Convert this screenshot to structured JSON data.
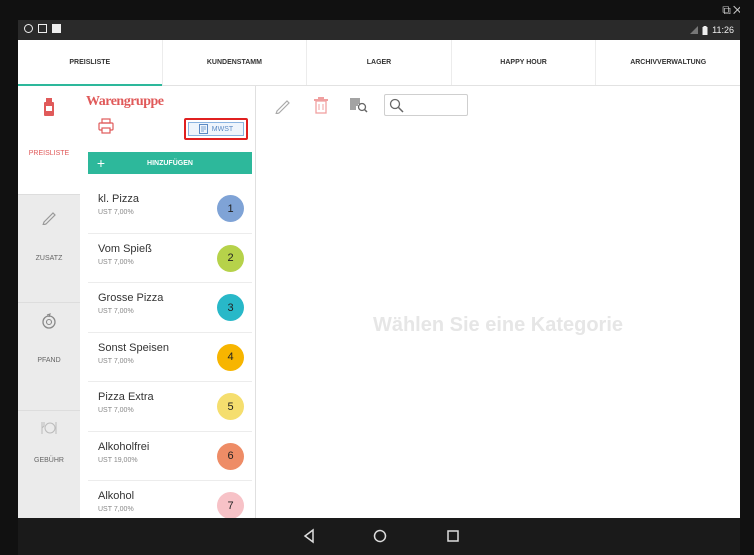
{
  "statusbar": {
    "time": "11:26"
  },
  "tabs": [
    {
      "label": "PREISLISTE",
      "active": true
    },
    {
      "label": "KUNDENSTAMM",
      "active": false
    },
    {
      "label": "LAGER",
      "active": false
    },
    {
      "label": "HAPPY HOUR",
      "active": false
    },
    {
      "label": "ARCHIVVERWALTUNG",
      "active": false
    }
  ],
  "sidebar": {
    "items": [
      {
        "label": "PREISLISTE",
        "icon": "bottle-icon",
        "active": true
      },
      {
        "label": "ZUSATZ",
        "icon": "pencil-icon",
        "active": false
      },
      {
        "label": "PFAND",
        "icon": "refresh-coin-icon",
        "active": false
      },
      {
        "label": "GEBÜHR",
        "icon": "cutlery-icon",
        "active": false
      }
    ]
  },
  "panel": {
    "title": "Warengruppe",
    "mwst_label": "MWST",
    "add_label": "HINZUFÜGEN"
  },
  "categories": [
    {
      "name": "kl. Pizza",
      "tax": "UST 7,00%",
      "num": "1",
      "color": "#7fa3d6"
    },
    {
      "name": "Vom Spieß",
      "tax": "UST 7,00%",
      "num": "2",
      "color": "#b6d24a"
    },
    {
      "name": "Grosse Pizza",
      "tax": "UST 7,00%",
      "num": "3",
      "color": "#28b8c8"
    },
    {
      "name": "Sonst Speisen",
      "tax": "UST 7,00%",
      "num": "4",
      "color": "#f7b500"
    },
    {
      "name": "Pizza Extra",
      "tax": "UST 7,00%",
      "num": "5",
      "color": "#f5de6e"
    },
    {
      "name": "Alkoholfrei",
      "tax": "UST 19,00%",
      "num": "6",
      "color": "#ee8c66"
    },
    {
      "name": "Alkohol",
      "tax": "UST 7,00%",
      "num": "7",
      "color": "#f7c2c7"
    }
  ],
  "search": {
    "placeholder": ""
  },
  "content": {
    "empty_message": "Wählen Sie eine Kategorie"
  },
  "colors": {
    "accent": "#2db89b",
    "brand_red": "#e05a5a",
    "highlight_border": "#e02020"
  }
}
